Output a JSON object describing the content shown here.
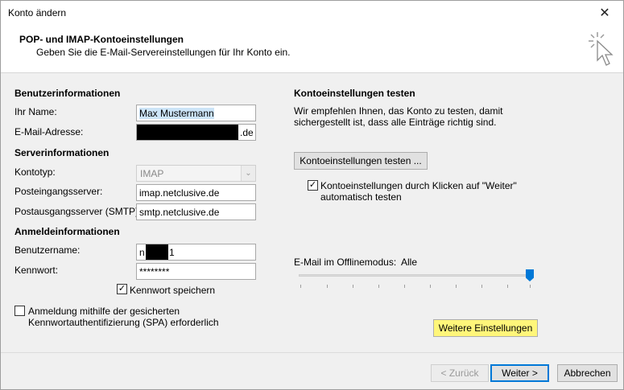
{
  "window": {
    "title": "Konto ändern",
    "close_glyph": "✕"
  },
  "header": {
    "title": "POP- und IMAP-Kontoeinstellungen",
    "subtitle": "Geben Sie die E-Mail-Servereinstellungen für Ihr Konto ein.",
    "icon": "cursor-click-icon"
  },
  "left": {
    "user_section": "Benutzerinformationen",
    "name_label": "Ihr Name:",
    "name_value": "Max Mustermann",
    "email_label": "E-Mail-Adresse:",
    "email_suffix": ".de",
    "server_section": "Serverinformationen",
    "type_label": "Kontotyp:",
    "type_value": "IMAP",
    "incoming_label": "Posteingangsserver:",
    "incoming_value": "imap.netclusive.de",
    "outgoing_label": "Postausgangsserver (SMTP):",
    "outgoing_value": "smtp.netclusive.de",
    "login_section": "Anmeldeinformationen",
    "username_label": "Benutzername:",
    "username_prefix": "n",
    "username_suffix": "1",
    "password_label": "Kennwort:",
    "password_value": "********",
    "save_password_label": "Kennwort speichern",
    "save_password_checked": true,
    "spa_label_1": "Anmeldung mithilfe der gesicherten",
    "spa_label_2": "Kennwortauthentifizierung (SPA) erforderlich",
    "spa_checked": false
  },
  "right": {
    "test_section": "Kontoeinstellungen testen",
    "test_desc_1": "Wir empfehlen Ihnen, das Konto zu testen, damit",
    "test_desc_2": "sichergestellt ist, dass alle Einträge richtig sind.",
    "test_button": "Kontoeinstellungen testen ...",
    "auto_test_label_1": "Kontoeinstellungen durch Klicken auf \"Weiter\"",
    "auto_test_label_2": "automatisch testen",
    "auto_test_checked": true,
    "offline_label": "E-Mail im Offlinemodus:",
    "offline_value": "Alle",
    "offline_level": 1.0,
    "more_settings_button": "Weitere Einstellungen"
  },
  "footer": {
    "back_button": "< Zurück",
    "next_button": "Weiter >",
    "cancel_button": "Abbrechen"
  },
  "colors": {
    "accent": "#0078d7",
    "highlight": "#fff67a",
    "redaction": "#000000"
  }
}
